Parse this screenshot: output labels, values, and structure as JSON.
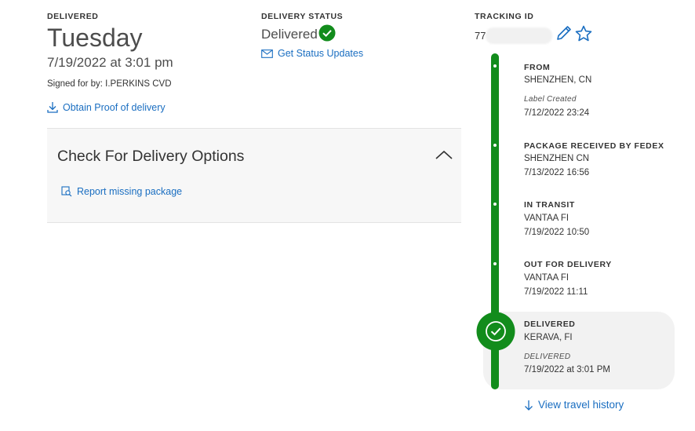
{
  "summary": {
    "delivered_label": "DELIVERED",
    "day": "Tuesday",
    "date_time": "7/19/2022 at 3:01 pm",
    "signed_for": "Signed for by: I.PERKINS CVD",
    "proof_link": "Obtain Proof of delivery"
  },
  "status": {
    "label": "DELIVERY STATUS",
    "value": "Delivered",
    "updates_link": "Get Status Updates"
  },
  "tracking": {
    "label": "TRACKING ID",
    "id_visible": "77"
  },
  "options": {
    "title": "Check For Delivery Options",
    "report_link": "Report missing package"
  },
  "timeline": [
    {
      "title": "FROM",
      "line1": "SHENZHEN, CN",
      "note": "Label Created",
      "time": "7/12/2022 23:24"
    },
    {
      "title": "PACKAGE RECEIVED BY FEDEX",
      "line1": "SHENZHEN CN",
      "time": "7/13/2022 16:56"
    },
    {
      "title": "IN TRANSIT",
      "line1": "VANTAA FI",
      "time": "7/19/2022 10:50"
    },
    {
      "title": "OUT FOR DELIVERY",
      "line1": "VANTAA FI",
      "time": "7/19/2022 11:11"
    },
    {
      "title": "DELIVERED",
      "line1": "KERAVA, FI",
      "note": "DELIVERED",
      "time": "7/19/2022 at 3:01 PM"
    }
  ],
  "history_link": "View travel history",
  "colors": {
    "brand_green": "#128c1c",
    "link_blue": "#1a6ec1",
    "panel_gray": "#f7f7f7"
  }
}
